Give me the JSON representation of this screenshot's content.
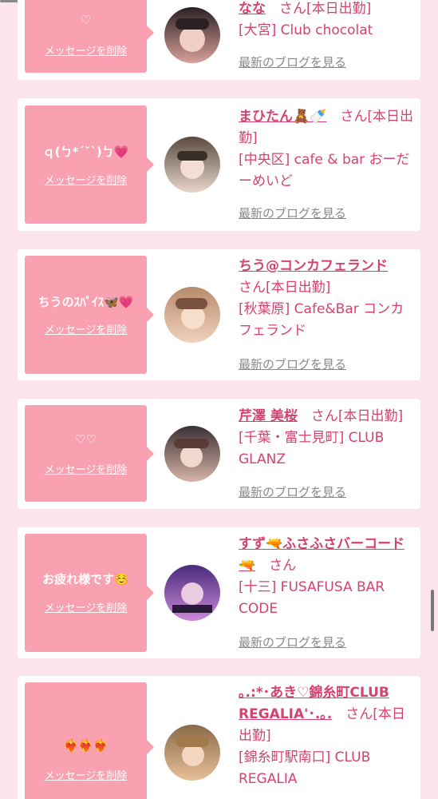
{
  "delete_label": "メッセージを削除",
  "blog_label": "最新のブログを見る",
  "cards": [
    {
      "message": "♡",
      "name": "なな",
      "san": "さん[本日出勤]",
      "shop": "[大宮] Club chocolat",
      "avatar_colors": [
        "#2b2024",
        "#d9a09a"
      ]
    },
    {
      "message": "ｑ(ㄅ*´˘`)ㄅ💗",
      "name": "まひたん🧸🍼",
      "san": "さん[本日出勤]",
      "shop": "[中央区] cafe & bar おーだーめいど",
      "avatar_colors": [
        "#5a4a40",
        "#e8d6cc"
      ]
    },
    {
      "message": "ちうのｽﾊﾟｲｽ🦋💗",
      "name": "ちう@コンカフェランド",
      "san": "さん[本日出勤]",
      "shop": "[秋葉原] Cafe&Bar コンカフェランド",
      "avatar_colors": [
        "#b88a6c",
        "#f0d2bd"
      ]
    },
    {
      "message": "♡♡",
      "name": "芹澤 美桜",
      "san": "さん[本日出勤]",
      "shop": "[千葉・富士見町] CLUB GLANZ",
      "avatar_colors": [
        "#3a3034",
        "#d8b4a8"
      ]
    },
    {
      "message": "お疲れ様です☺️",
      "name": "すず🔫ふさふさバーコード🔫",
      "san": "さん",
      "shop": "[十三] FUSAFUSA BAR CODE",
      "avatar_colors": [
        "#4a2a7a",
        "#c98ad8"
      ]
    },
    {
      "message": "❤️‍🔥❤️‍🔥❤️‍🔥",
      "name": "｡.:*･あき♡錦糸町CLUB REGALIA'･.｡.",
      "san": "さん[本日出勤]",
      "shop": "[錦糸町駅南口] CLUB REGALIA",
      "avatar_colors": [
        "#8a6a4a",
        "#e8c09a"
      ]
    }
  ]
}
